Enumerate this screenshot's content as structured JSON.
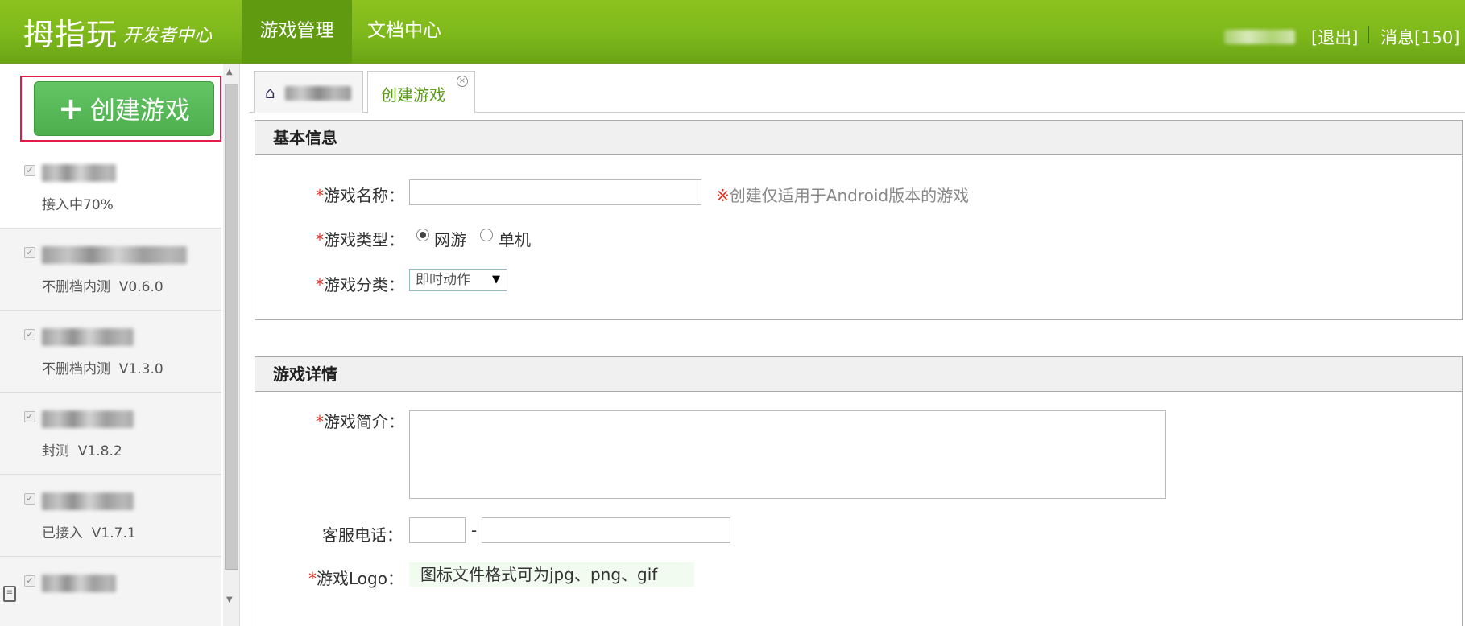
{
  "header": {
    "logo": "拇指玩",
    "subtitle": "开发者中心",
    "nav": [
      {
        "label": "游戏管理",
        "active": true
      },
      {
        "label": "文档中心",
        "active": false
      }
    ],
    "logout": "[退出]",
    "messages": "消息[150]"
  },
  "sidebar": {
    "create_button": "创建游戏",
    "games": [
      {
        "status": "接入中70%"
      },
      {
        "status": "不删档内测  V0.6.0"
      },
      {
        "status": "不删档内测  V1.3.0"
      },
      {
        "status": "封测  V1.8.2"
      },
      {
        "status": "已接入  V1.7.1"
      },
      {
        "status": ""
      }
    ]
  },
  "tabs": {
    "active_label": "创建游戏"
  },
  "basic_info": {
    "title": "基本信息",
    "name_label": "游戏名称：",
    "name_value": "",
    "name_hint": "创建仅适用于Android版本的游戏",
    "name_hint_mark": "※",
    "type_label": "游戏类型：",
    "type_options": [
      "网游",
      "单机"
    ],
    "type_selected": "网游",
    "category_label": "游戏分类：",
    "category_value": "即时动作"
  },
  "details": {
    "title": "游戏详情",
    "intro_label": "游戏简介：",
    "phone_label": "客服电话：",
    "phone_sep": "-",
    "logo_label": "游戏Logo：",
    "logo_hint": "图标文件格式可为jpg、png、gif"
  },
  "colors": {
    "header_green": "#7db81b",
    "active_nav": "#609a11",
    "create_button": "#4cae4c",
    "highlight_border": "#e5194a",
    "required_star": "#e0301e"
  }
}
